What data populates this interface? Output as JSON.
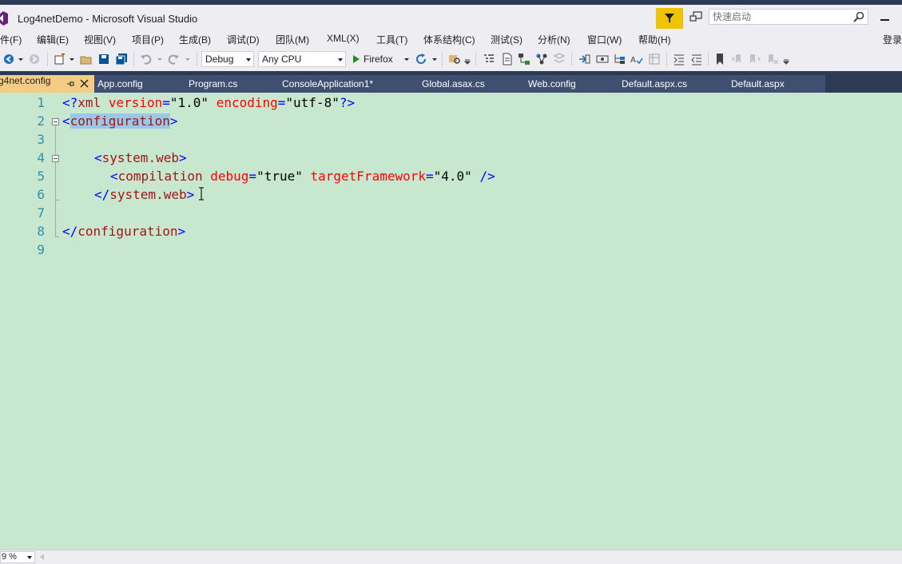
{
  "window": {
    "title": "Log4netDemo - Microsoft Visual Studio",
    "quick_launch_placeholder": "快速启动",
    "sign_in": "登录"
  },
  "menu": [
    "件(F)",
    "编辑(E)",
    "视图(V)",
    "项目(P)",
    "生成(B)",
    "调试(D)",
    "团队(M)",
    "XML(X)",
    "工具(T)",
    "体系结构(C)",
    "测试(S)",
    "分析(N)",
    "窗口(W)",
    "帮助(H)"
  ],
  "toolbar": {
    "configuration": "Debug",
    "platform": "Any CPU",
    "run_target": "Firefox"
  },
  "tabs": {
    "active": "g4net.config",
    "others": [
      "App.config",
      "Program.cs",
      "ConsoleApplication1*",
      "Global.asax.cs",
      "Web.config",
      "Default.aspx.cs",
      "Default.aspx"
    ]
  },
  "editor": {
    "line_numbers": [
      "1",
      "2",
      "3",
      "4",
      "5",
      "6",
      "7",
      "8",
      "9"
    ],
    "code": {
      "l1": {
        "open": "<?",
        "tag": "xml",
        "a1": "version",
        "eq1": "=",
        "v1": "\"1.0\"",
        "a2": "encoding",
        "eq2": "=",
        "v2": "\"utf-8\"",
        "close": "?>"
      },
      "l2": {
        "lt": "<",
        "tag": "configuration",
        "gt": ">"
      },
      "l4": {
        "lt": "<",
        "tag": "system.web",
        "gt": ">"
      },
      "l5": {
        "lt": "<",
        "tag": "compilation",
        "a1": "debug",
        "eq1": "=",
        "v1": "\"true\"",
        "a2": "targetFramework",
        "eq2": "=",
        "v2": "\"4.0\"",
        "close": "/>"
      },
      "l6": {
        "lt": "</",
        "tag": "system.web",
        "gt": ">"
      },
      "l8": {
        "lt": "</",
        "tag": "configuration",
        "gt": ">"
      }
    }
  },
  "status": {
    "zoom": "9 %"
  },
  "colors": {
    "editor_bg": "#c7e8cf",
    "tab_active": "#f5cc84",
    "tab_bar": "#2d3a55",
    "notification": "#f0c300"
  }
}
